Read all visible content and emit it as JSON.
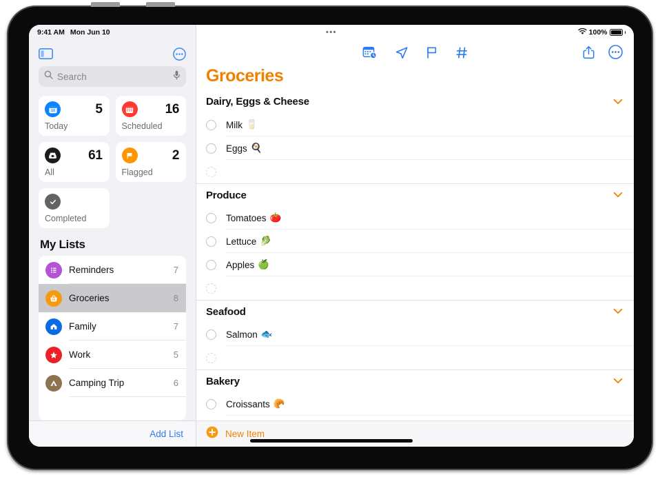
{
  "status_bar": {
    "time": "9:41 AM",
    "date": "Mon Jun 10",
    "dots": "•••",
    "battery_percent": "100%",
    "wifi_icon": "wifi-icon",
    "battery_icon": "battery-full-icon"
  },
  "sidebar": {
    "toggle_icon": "sidebar-toggle-icon",
    "more_icon": "more-circle-icon",
    "search": {
      "placeholder": "Search",
      "search_icon": "search-icon",
      "mic_icon": "microphone-icon"
    },
    "smart_lists": [
      {
        "label": "Today",
        "count": "5",
        "icon": "calendar-today-icon",
        "icon_color": "#0a84ff",
        "day_number": "10"
      },
      {
        "label": "Scheduled",
        "count": "16",
        "icon": "calendar-icon",
        "icon_color": "#ff3b30"
      },
      {
        "label": "All",
        "count": "61",
        "icon": "inbox-tray-icon",
        "icon_color": "#1c1c1e"
      },
      {
        "label": "Flagged",
        "count": "2",
        "icon": "flag-icon",
        "icon_color": "#ff9500"
      },
      {
        "label": "Completed",
        "count": "",
        "icon": "check-circle-icon",
        "icon_color": "#636366"
      }
    ],
    "my_lists_title": "My Lists",
    "lists": [
      {
        "name": "Reminders",
        "count": "7",
        "icon": "bulleted-list-icon",
        "icon_color": "#b254d4",
        "selected": false
      },
      {
        "name": "Groceries",
        "count": "8",
        "icon": "basket-icon",
        "icon_color": "#f59b12",
        "selected": true
      },
      {
        "name": "Family",
        "count": "7",
        "icon": "house-icon",
        "icon_color": "#0a6ce0",
        "selected": false
      },
      {
        "name": "Work",
        "count": "5",
        "icon": "star-icon",
        "icon_color": "#ec2027",
        "selected": false
      },
      {
        "name": "Camping Trip",
        "count": "6",
        "icon": "tent-icon",
        "icon_color": "#8d7350",
        "selected": false
      }
    ],
    "add_list_label": "Add List",
    "add_list_color": "#2b7cf0"
  },
  "main": {
    "toolbar": {
      "icons": [
        {
          "name": "calendar-clock-icon",
          "label": "Scheduled"
        },
        {
          "name": "location-arrow-icon",
          "label": "Location"
        },
        {
          "name": "flag-icon",
          "label": "Flag"
        },
        {
          "name": "hashtag-icon",
          "label": "Tags"
        }
      ],
      "share_icon": "share-icon",
      "more_icon": "more-circle-icon",
      "tint": "#2b7cf0"
    },
    "title": "Groceries",
    "title_color": "#f08100",
    "sections": [
      {
        "title": "Dairy, Eggs & Cheese",
        "chevron_icon": "chevron-down-icon",
        "items": [
          {
            "text": "Milk",
            "emoji": "🥛"
          },
          {
            "text": "Eggs",
            "emoji": "🍳"
          },
          {
            "text": "",
            "emoji": "",
            "placeholder": true
          }
        ]
      },
      {
        "title": "Produce",
        "chevron_icon": "chevron-down-icon",
        "items": [
          {
            "text": "Tomatoes",
            "emoji": "🍅"
          },
          {
            "text": "Lettuce",
            "emoji": "🥬"
          },
          {
            "text": "Apples",
            "emoji": "🍏"
          },
          {
            "text": "",
            "emoji": "",
            "placeholder": true
          }
        ]
      },
      {
        "title": "Seafood",
        "chevron_icon": "chevron-down-icon",
        "items": [
          {
            "text": "Salmon",
            "emoji": "🐟"
          },
          {
            "text": "",
            "emoji": "",
            "placeholder": true
          }
        ]
      },
      {
        "title": "Bakery",
        "chevron_icon": "chevron-down-icon",
        "items": [
          {
            "text": "Croissants",
            "emoji": "🥐"
          }
        ]
      }
    ],
    "new_item": {
      "label": "New Item",
      "plus_icon": "plus-circle-icon",
      "color": "#f08100"
    }
  }
}
